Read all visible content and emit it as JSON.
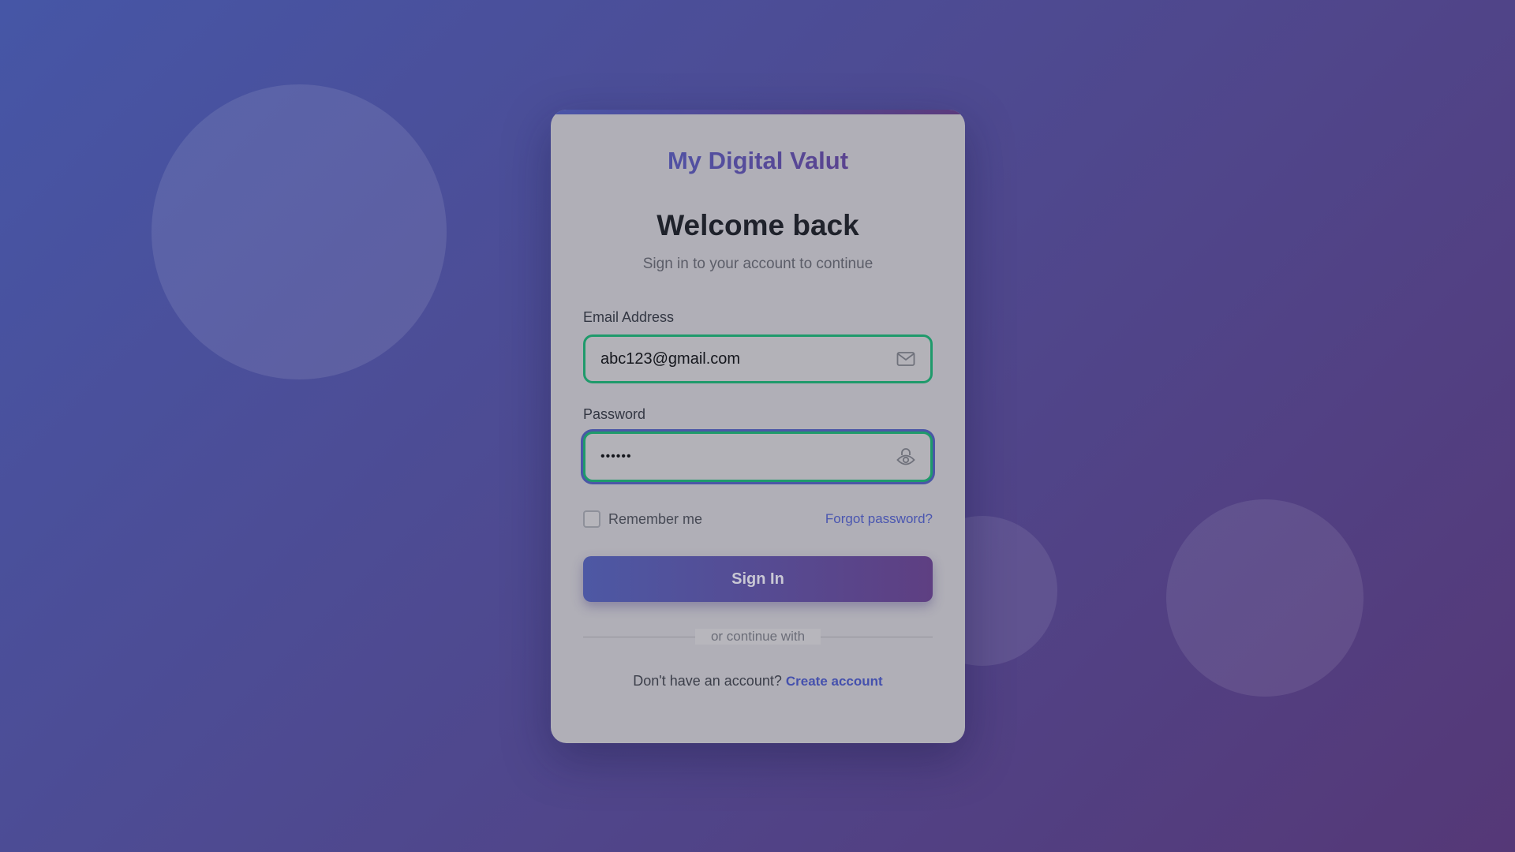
{
  "brand": {
    "name": "My Digital Valut"
  },
  "header": {
    "title": "Welcome back",
    "subtitle": "Sign in to your account to continue"
  },
  "form": {
    "email": {
      "label": "Email Address",
      "value": "abc123@gmail.com",
      "icon": "mail-icon"
    },
    "password": {
      "label": "Password",
      "value": "••••••",
      "icon": "eye-icon"
    },
    "remember_label": "Remember me",
    "remember_checked": false,
    "forgot_label": "Forgot password?",
    "submit_label": "Sign In"
  },
  "divider": {
    "label": "or continue with"
  },
  "signup": {
    "prompt": "Don't have an account?",
    "link_label": "Create account"
  },
  "colors": {
    "accent": "#4a56b0",
    "accent_end": "#5e3f82",
    "field_border": "#1f9a6b"
  }
}
